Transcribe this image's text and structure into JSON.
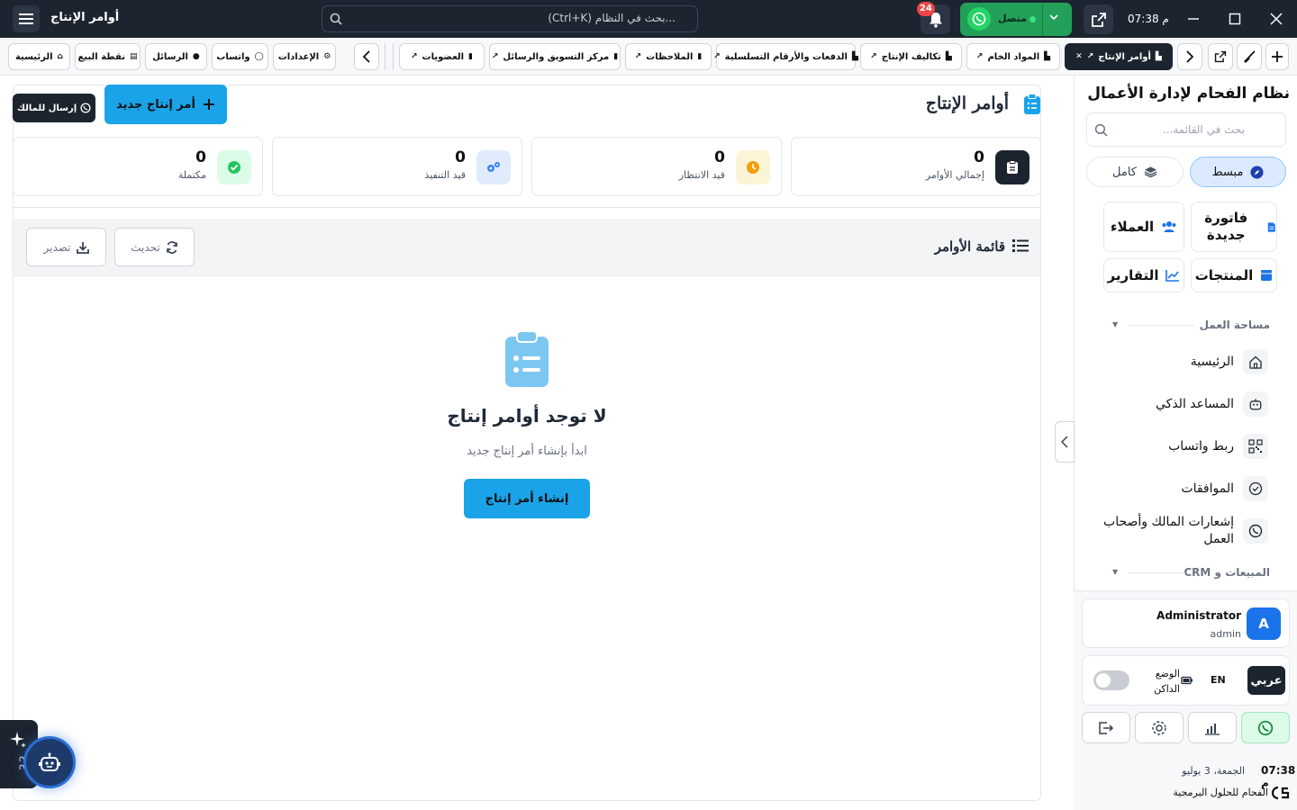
{
  "titlebar": {
    "app_title": "أوامر الإنتاج",
    "search_placeholder": "...بحث في النظام (Ctrl+K)",
    "notifications_count": "24",
    "whatsapp_status": "متصل",
    "clock": "07:38 م"
  },
  "tabs": {
    "open": [
      {
        "label": "أوامر الإنتاج",
        "active": true
      },
      {
        "label": "المواد الخام"
      },
      {
        "label": "تكاليف الإنتاج"
      },
      {
        "label": "الدفعات والأرقام التسلسلية"
      },
      {
        "label": "الملاحظات"
      },
      {
        "label": "مركز التسويق والرسائل"
      },
      {
        "label": "العضويات"
      }
    ],
    "quick": [
      {
        "label": "الإعدادات"
      },
      {
        "label": "واتساب"
      },
      {
        "label": "الرسائل"
      },
      {
        "label": "نقطة البيع"
      },
      {
        "label": "الرئيسية"
      }
    ]
  },
  "page": {
    "title": "أوامر الإنتاج",
    "new_order_label": "أمر إنتاج جديد",
    "send_owner_label": "إرسال للمالك",
    "stats": [
      {
        "value": "0",
        "label": "إجمالي الأوامر",
        "color": "#1c2430"
      },
      {
        "value": "0",
        "label": "قيد الانتظار",
        "color": "#f59e0b"
      },
      {
        "value": "0",
        "label": "قيد التنفيذ",
        "color": "#3b82f6"
      },
      {
        "value": "0",
        "label": "مكتملة",
        "color": "#22c55e"
      }
    ],
    "list_title": "قائمة الأوامر",
    "refresh_label": "تحديث",
    "export_label": "تصدير",
    "empty_title": "لا توجد أوامر إنتاج",
    "empty_subtitle": "ابدأ بإنشاء أمر إنتاج جديد",
    "create_label": "إنشاء أمر إنتاج"
  },
  "ai_panel": {
    "label": "ع ع"
  },
  "sidebar": {
    "brand": "نظام الفحام لإدارة الأعمال",
    "search_placeholder": "بحث في القائمة...",
    "mode_simple": "مبسط",
    "mode_full": "كامل",
    "quick_actions": [
      {
        "label": "فاتورة جديدة"
      },
      {
        "label": "العملاء"
      },
      {
        "label": "المنتجات"
      },
      {
        "label": "التقارير"
      }
    ],
    "section_workspace": "مساحة العمل",
    "nav": [
      {
        "label": "الرئيسية"
      },
      {
        "label": "المساعد الذكي"
      },
      {
        "label": "ربط واتساب"
      },
      {
        "label": "الموافقات"
      },
      {
        "label": "إشعارات المالك وأصحاب العمل"
      }
    ],
    "section_sales": "المبيعات و CRM",
    "user": {
      "initial": "A",
      "name": "Administrator",
      "role": "admin"
    },
    "lang_ar": "عربي",
    "lang_en": "EN",
    "dark_mode": "الوضع الداكن",
    "footer_time": "07:38 م",
    "footer_date": "الجمعة، 3 يوليو",
    "company": "الفحام للحلول البرمجية"
  },
  "colors": {
    "accent": "#1aa3e8",
    "dark": "#1c2430",
    "whatsapp": "#22a05a"
  }
}
